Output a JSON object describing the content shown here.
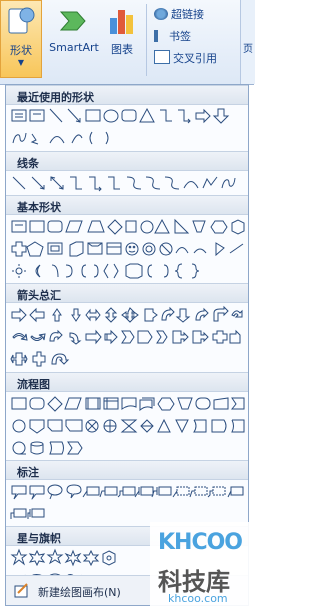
{
  "ribbon": {
    "shapes_label": "形状",
    "smartart_label": "SmartArt",
    "chart_label": "图表",
    "hyperlink_label": "超链接",
    "bookmark_label": "书签",
    "crossref_label": "交叉引用",
    "edge_label": "页"
  },
  "panel": {
    "sections": [
      {
        "label": "最近使用的形状"
      },
      {
        "label": "线条"
      },
      {
        "label": "基本形状"
      },
      {
        "label": "箭头总汇"
      },
      {
        "label": "流程图"
      },
      {
        "label": "标注"
      },
      {
        "label": "星与旗帜"
      }
    ],
    "footer_label": "新建绘图画布(N)"
  },
  "watermark": {
    "brand": "KHCOO",
    "cn": "科技库",
    "url": "khcoo.com"
  }
}
